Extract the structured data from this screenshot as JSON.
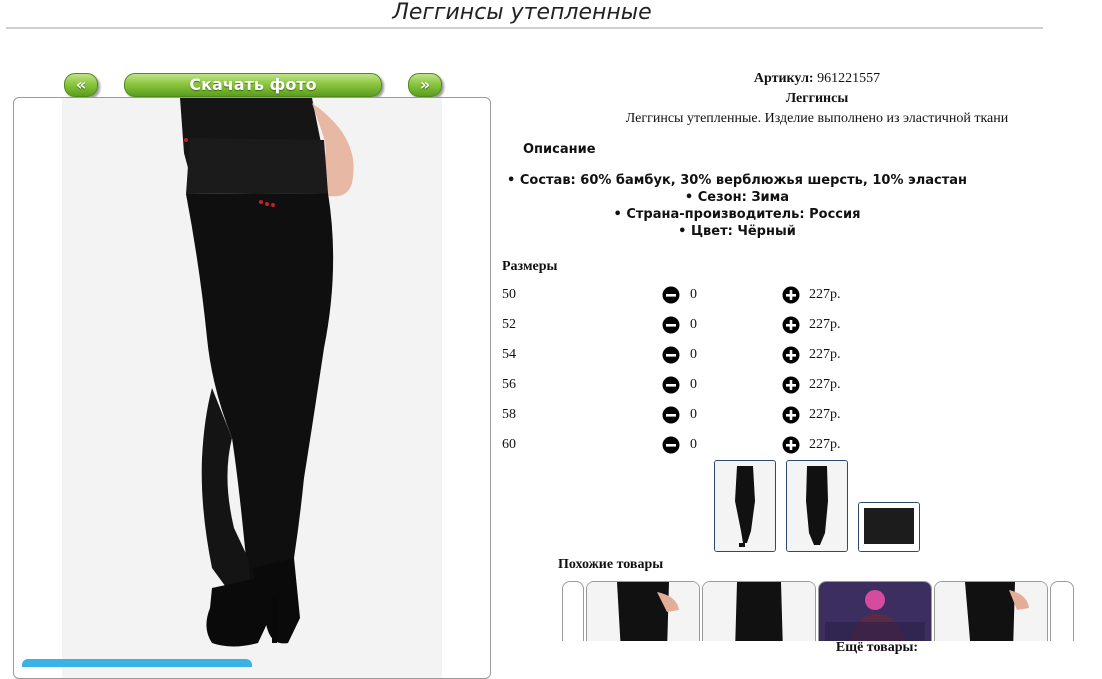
{
  "page": {
    "title": "Леггинсы утепленные"
  },
  "gallery": {
    "prev_label": "«",
    "download_label": "Скачать фото",
    "next_label": "»"
  },
  "product": {
    "article_label": "Артикул:",
    "article_value": "961221557",
    "short_name": "Леггинсы",
    "long_description": "Леггинсы утепленные. Изделие выполнено из эластичной ткани",
    "description_heading": "Описание",
    "attributes": [
      "Состав: 60% бамбук, 30% верблюжья шерсть, 10% эластан",
      "Сезон: Зима",
      "Страна-производитель: Россия",
      "Цвет: Чёрный"
    ]
  },
  "sizes": {
    "heading": "Размеры",
    "rows": [
      {
        "size": "50",
        "qty": "0",
        "price": "227р."
      },
      {
        "size": "52",
        "qty": "0",
        "price": "227р."
      },
      {
        "size": "54",
        "qty": "0",
        "price": "227р."
      },
      {
        "size": "56",
        "qty": "0",
        "price": "227р."
      },
      {
        "size": "58",
        "qty": "0",
        "price": "227р."
      },
      {
        "size": "60",
        "qty": "0",
        "price": "227р."
      }
    ]
  },
  "similar": {
    "heading": "Похожие товары"
  },
  "more": {
    "heading": "Ещё товары:"
  },
  "colors": {
    "accent_green": "#8cc63f",
    "thumb_border": "#2d4a6b",
    "product_black": "#111111"
  }
}
